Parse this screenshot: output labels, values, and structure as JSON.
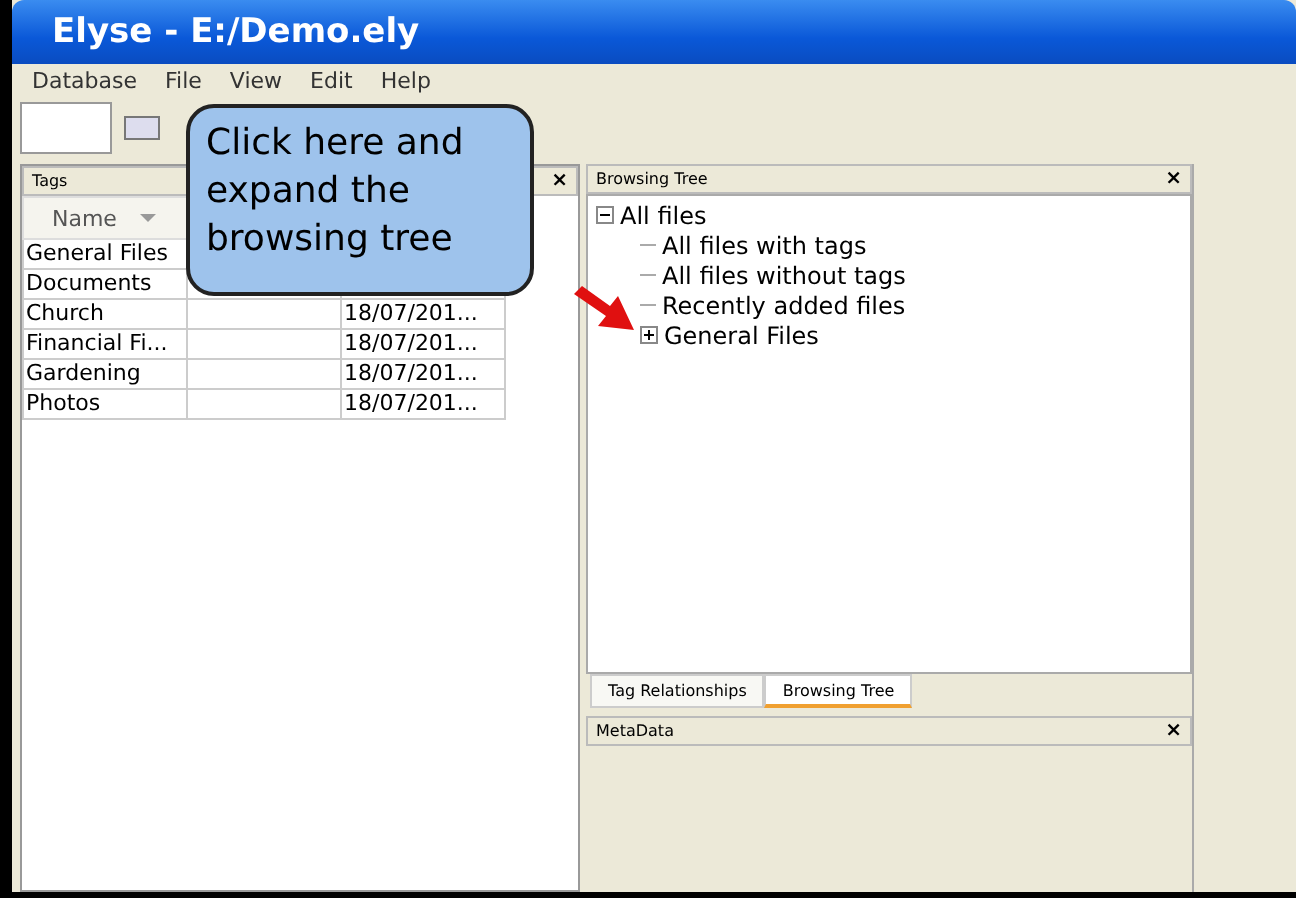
{
  "window": {
    "title": "Elyse - E:/Demo.ely"
  },
  "menu": [
    "Database",
    "File",
    "View",
    "Edit",
    "Help"
  ],
  "tags_panel": {
    "title": "Tags",
    "close": "×",
    "columns": [
      "Name"
    ],
    "rows": [
      {
        "cells": [
          "General Files",
          "",
          ""
        ]
      },
      {
        "cells": [
          "Documents",
          "",
          ""
        ]
      },
      {
        "cells": [
          "Church",
          "",
          "18/07/201..."
        ]
      },
      {
        "cells": [
          "Financial Fi...",
          "",
          "18/07/201..."
        ]
      },
      {
        "cells": [
          "Gardening",
          "",
          "18/07/201..."
        ]
      },
      {
        "cells": [
          "Photos",
          "",
          "18/07/201..."
        ]
      }
    ]
  },
  "browsing_panel": {
    "title": "Browsing Tree",
    "close": "×",
    "tree": [
      {
        "label": "All files",
        "expanded": true,
        "children": [
          {
            "label": "All files with tags"
          },
          {
            "label": "All files without tags"
          },
          {
            "label": "Recently added files"
          },
          {
            "label": "General Files",
            "expanded": false
          }
        ]
      }
    ],
    "tabs": [
      {
        "label": "Tag Relationships",
        "selected": false
      },
      {
        "label": "Browsing Tree",
        "selected": true
      }
    ]
  },
  "metadata_panel": {
    "title": "MetaData",
    "close": "×"
  },
  "callout": {
    "text": "Click here and expand the browsing tree"
  }
}
